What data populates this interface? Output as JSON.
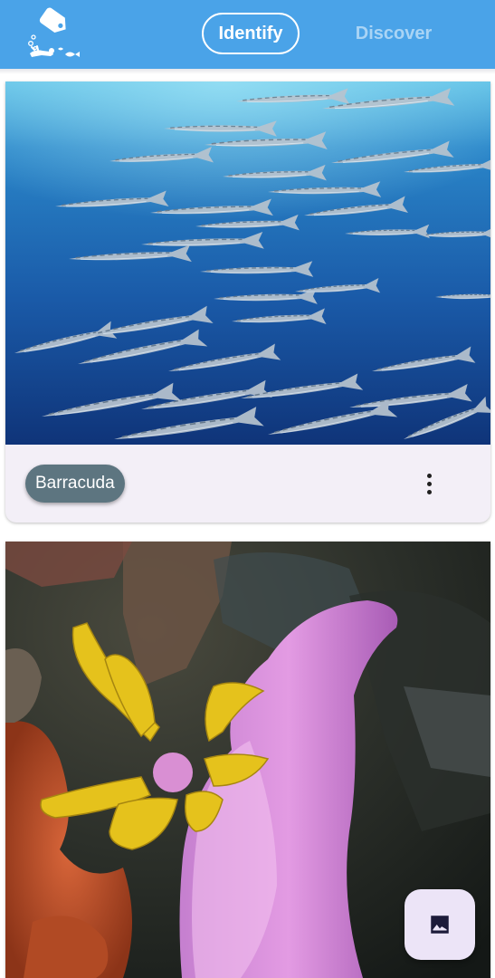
{
  "header": {
    "tabs": [
      {
        "label": "Identify",
        "active": true
      },
      {
        "label": "Discover",
        "active": false
      }
    ],
    "logo_icon": "diver-tag-logo"
  },
  "cards": [
    {
      "label": "Barracuda",
      "image": "barracuda-school-photo",
      "menu_icon": "more-vert-icon"
    },
    {
      "image": "pink-nudibranch-photo"
    }
  ],
  "fab": {
    "icon": "image-icon"
  },
  "colors": {
    "appbar": "#4aa3e8",
    "chip": "#5d7580",
    "card": "#f3eff7",
    "fab": "#ece4f7"
  }
}
